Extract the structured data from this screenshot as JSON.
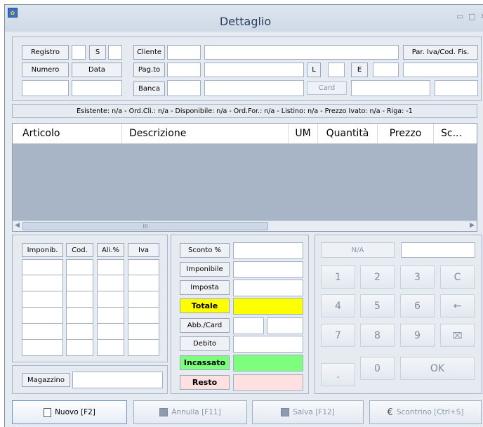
{
  "window": {
    "title": "Dettaglio",
    "controls": {
      "minimize": "▭",
      "maximize": "□",
      "close": "✕"
    }
  },
  "header": {
    "registro_label": "Registro",
    "s_label": "S",
    "cliente_label": "Cliente",
    "piva_label": "Par. Iva/Cod. Fis.",
    "numero_label": "Numero",
    "data_label": "Data",
    "pagto_label": "Pag.to",
    "l_label": "L",
    "e_label": "E",
    "banca_label": "Banca",
    "card_button": "Card"
  },
  "info_bar": "Esistente: n/a - Ord.Cli.: n/a - Disponibile: n/a - Ord.For.: n/a - Listino: n/a - Prezzo Ivato: n/a - Riga: -1",
  "grid": {
    "columns": [
      "Articolo",
      "Descrizione",
      "UM",
      "Quantità",
      "Prezzo",
      "Sc..."
    ],
    "scroll_grip": "III"
  },
  "iva_table": {
    "headers": [
      "Imponib.",
      "Cod.",
      "Ali.%",
      "Iva"
    ],
    "rows": 6
  },
  "magazzino_label": "Magazzino",
  "totals": {
    "sconto": "Sconto %",
    "imponibile": "Imponibile",
    "imposta": "Imposta",
    "totale": "Totale",
    "abb_card": "Abb./Card",
    "debito": "Debito",
    "incassato": "Incassato",
    "resto": "Resto"
  },
  "keypad": {
    "display_label": "N/A",
    "keys": [
      "1",
      "2",
      "3",
      "C",
      "4",
      "5",
      "6",
      "←",
      "7",
      "8",
      "9",
      "⌧",
      ".",
      "0",
      "OK"
    ]
  },
  "buttons": {
    "nuovo": "Nuovo [F2]",
    "annulla": "Annulla [F11]",
    "salva": "Salva [F12]",
    "scontrino": "Scontrino [Ctrl+S]"
  },
  "colors": {
    "totale_bg": "#ffff00",
    "incassato_bg": "#7dff7d",
    "resto_bg": "#ffe0e0",
    "window_bg": "#e6ebf2"
  }
}
